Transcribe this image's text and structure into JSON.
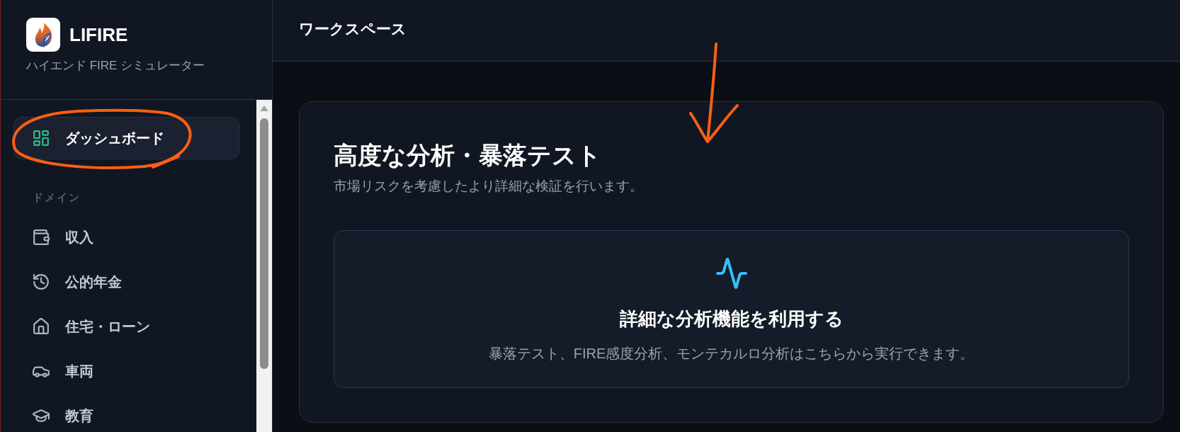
{
  "sidebar": {
    "brand": "LIFIRE",
    "tagline": "ハイエンド FIRE シミュレーター",
    "items": [
      {
        "label": "ダッシュボード",
        "selected": true
      }
    ],
    "sections": [
      {
        "title": "ドメイン",
        "items": [
          {
            "label": "収入",
            "selected": false
          },
          {
            "label": "公的年金",
            "selected": false
          },
          {
            "label": "住宅・ローン",
            "selected": false
          },
          {
            "label": "車両",
            "selected": false
          },
          {
            "label": "教育",
            "selected": false
          }
        ]
      }
    ]
  },
  "header": {
    "title": "ワークスペース"
  },
  "panel": {
    "title": "高度な分析・暴落テスト",
    "subtitle": "市場リスクを考慮したより詳細な検証を行います。",
    "feature": {
      "title": "詳細な分析機能を利用する",
      "description": "暴落テスト、FIRE感度分析、モンテカルロ分析はこちらから実行できます。"
    }
  },
  "annotations": [
    {
      "kind": "loop"
    },
    {
      "kind": "arrow"
    }
  ]
}
